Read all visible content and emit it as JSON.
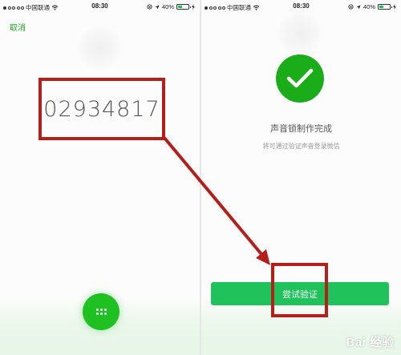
{
  "status_bar": {
    "carrier": "中国联通",
    "time": "08:30",
    "battery": "40%",
    "battery_level": 0.4
  },
  "left_screen": {
    "cancel_label": "取消",
    "voice_code": "02934817"
  },
  "right_screen": {
    "success_title": "声音锁制作完成",
    "success_subtitle": "将可通过验证声音登录微信",
    "try_verify_label": "尝试验证"
  },
  "watermark_text": "Bai 经验",
  "colors": {
    "wechat_green": "#1aad19",
    "button_green": "#1fc25b",
    "annotation_red": "#b41f1c"
  },
  "icons": {
    "wifi": "wifi-icon",
    "location": "location-arrow-icon",
    "lock_rotation": "orientation-lock-icon",
    "battery": "battery-icon",
    "check": "checkmark-icon",
    "keypad": "dots-grid-icon"
  }
}
